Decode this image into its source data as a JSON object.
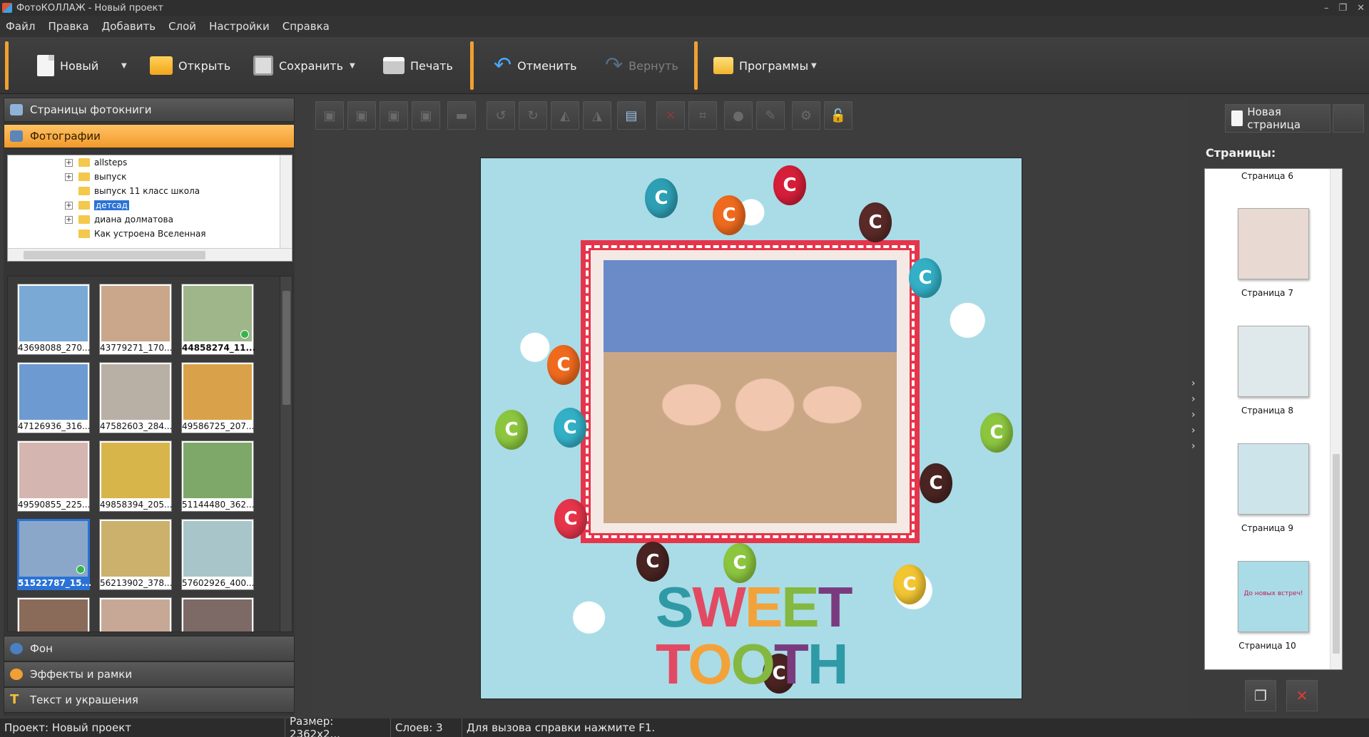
{
  "window": {
    "title": "ФотоКОЛЛАЖ - Новый проект"
  },
  "menu": [
    "Файл",
    "Правка",
    "Добавить",
    "Слой",
    "Настройки",
    "Справка"
  ],
  "toolbar": {
    "new": "Новый",
    "open": "Открыть",
    "save": "Сохранить",
    "print": "Печать",
    "undo": "Отменить",
    "redo": "Вернуть",
    "programs": "Программы"
  },
  "left_panel": {
    "pages_section": "Страницы фотокниги",
    "photos_section": "Фотографии",
    "tree": [
      {
        "label": "allsteps",
        "expandable": true
      },
      {
        "label": "выпуск",
        "expandable": true
      },
      {
        "label": "выпуск 11 класс школа",
        "expandable": false
      },
      {
        "label": "детсад",
        "expandable": true,
        "selected": true
      },
      {
        "label": "диана долматова",
        "expandable": true
      },
      {
        "label": "Как устроена Вселенная",
        "expandable": false
      }
    ],
    "thumbnails": [
      {
        "caption": "43698088_270...",
        "color": "#7aa9d6"
      },
      {
        "caption": "43779271_170...",
        "color": "#caa68a"
      },
      {
        "caption": "44858274_11...",
        "color": "#9fb58a",
        "bold": true,
        "used": true
      },
      {
        "caption": "47126936_316...",
        "color": "#6d9ad0"
      },
      {
        "caption": "47582603_284...",
        "color": "#b9b0a5"
      },
      {
        "caption": "49586725_207...",
        "color": "#d9a24a"
      },
      {
        "caption": "49590855_225...",
        "color": "#d4b5b0"
      },
      {
        "caption": "49858394_205...",
        "color": "#d8b54a"
      },
      {
        "caption": "51144480_362...",
        "color": "#7ea86a"
      },
      {
        "caption": "51522787_15...",
        "color": "#8aa7c9",
        "selected": true,
        "used": true
      },
      {
        "caption": "56213902_378...",
        "color": "#cbb16b"
      },
      {
        "caption": "57602926_400...",
        "color": "#a8c6c9"
      },
      {
        "caption": "",
        "color": "#8a6b5a"
      },
      {
        "caption": "",
        "color": "#c7a897"
      },
      {
        "caption": "",
        "color": "#7d6a66"
      }
    ],
    "bottom_sections": [
      "Фон",
      "Эффекты и рамки",
      "Текст и украшения"
    ]
  },
  "canvas": {
    "title_text": "SWEET TOOTH",
    "candy_letter": "C",
    "colors": {
      "background": "#a9dce6",
      "frame": "#e6344a"
    }
  },
  "right_panel": {
    "new_page": "Новая страница",
    "pages_title": "Страницы:",
    "pages": [
      {
        "label": "Страница 6"
      },
      {
        "label": "Страница 7",
        "color": "#e8d9d2"
      },
      {
        "label": "Страница 8",
        "color": "#dfe8ea"
      },
      {
        "label": "Страница 9",
        "color": "#cde4ea"
      },
      {
        "label": "Страница 10",
        "color": "#a9dce6",
        "inner_text": "До новых встреч!"
      }
    ]
  },
  "statusbar": {
    "project": "Проект:  Новый проект",
    "size": "Размер:  2362x2...",
    "layers": "Слоев:  3",
    "hint": "Для вызова справки нажмите F1."
  }
}
